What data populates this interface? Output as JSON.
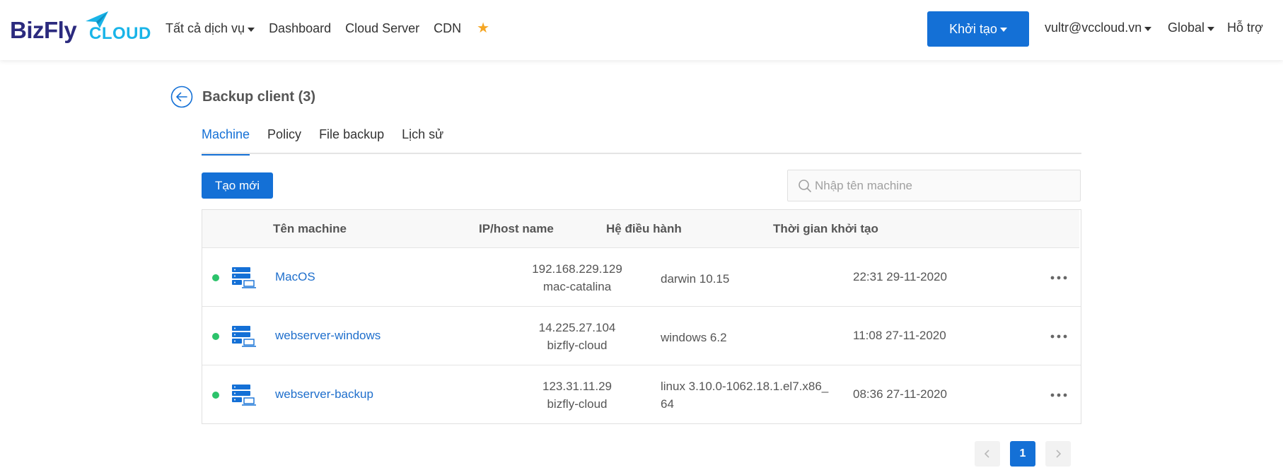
{
  "brand": {
    "name_main": "BizFly",
    "name_sub": "CLOUD",
    "colors": {
      "main": "#2b2a7e",
      "sub": "#19b4e8"
    }
  },
  "nav": {
    "all_services": "Tất cả dịch vụ",
    "dashboard": "Dashboard",
    "cloud_server": "Cloud Server",
    "cdn": "CDN",
    "favorites_icon": "star-icon",
    "create_label": "Khởi tạo",
    "user": "vultr@vccloud.vn",
    "region": "Global",
    "support": "Hỗ trợ"
  },
  "page": {
    "title": "Backup client (3)",
    "back_icon": "arrow-left-circle-icon"
  },
  "tabs": [
    {
      "label": "Machine",
      "active": true
    },
    {
      "label": "Policy",
      "active": false
    },
    {
      "label": "File backup",
      "active": false
    },
    {
      "label": "Lịch sử",
      "active": false
    }
  ],
  "toolbar": {
    "new_label": "Tạo mới",
    "search_placeholder": "Nhập tên machine"
  },
  "table": {
    "columns": [
      "Tên machine",
      "IP/host name",
      "Hệ điều hành",
      "Thời gian khởi tạo"
    ],
    "rows": [
      {
        "status": "online",
        "name": "MacOS",
        "ip": "192.168.229.129",
        "host": "mac-catalina",
        "os_line1": "darwin 10.15",
        "os_line2": "",
        "created": "22:31 29-11-2020"
      },
      {
        "status": "online",
        "name": "webserver-windows",
        "ip": "14.225.27.104",
        "host": "bizfly-cloud",
        "os_line1": "windows 6.2",
        "os_line2": "",
        "created": "11:08 27-11-2020"
      },
      {
        "status": "online",
        "name": "webserver-backup",
        "ip": "123.31.11.29",
        "host": "bizfly-cloud",
        "os_line1": "linux 3.10.0-1062.18.1.el7.x86_",
        "os_line2": "64",
        "created": "08:36 27-11-2020"
      }
    ]
  },
  "pagination": {
    "current_page": "1",
    "prev_icon": "chevron-left-icon",
    "next_icon": "chevron-right-icon"
  },
  "colors": {
    "accent": "#1470d6",
    "status_online": "#2cc36b",
    "favorite": "#f5a623"
  }
}
